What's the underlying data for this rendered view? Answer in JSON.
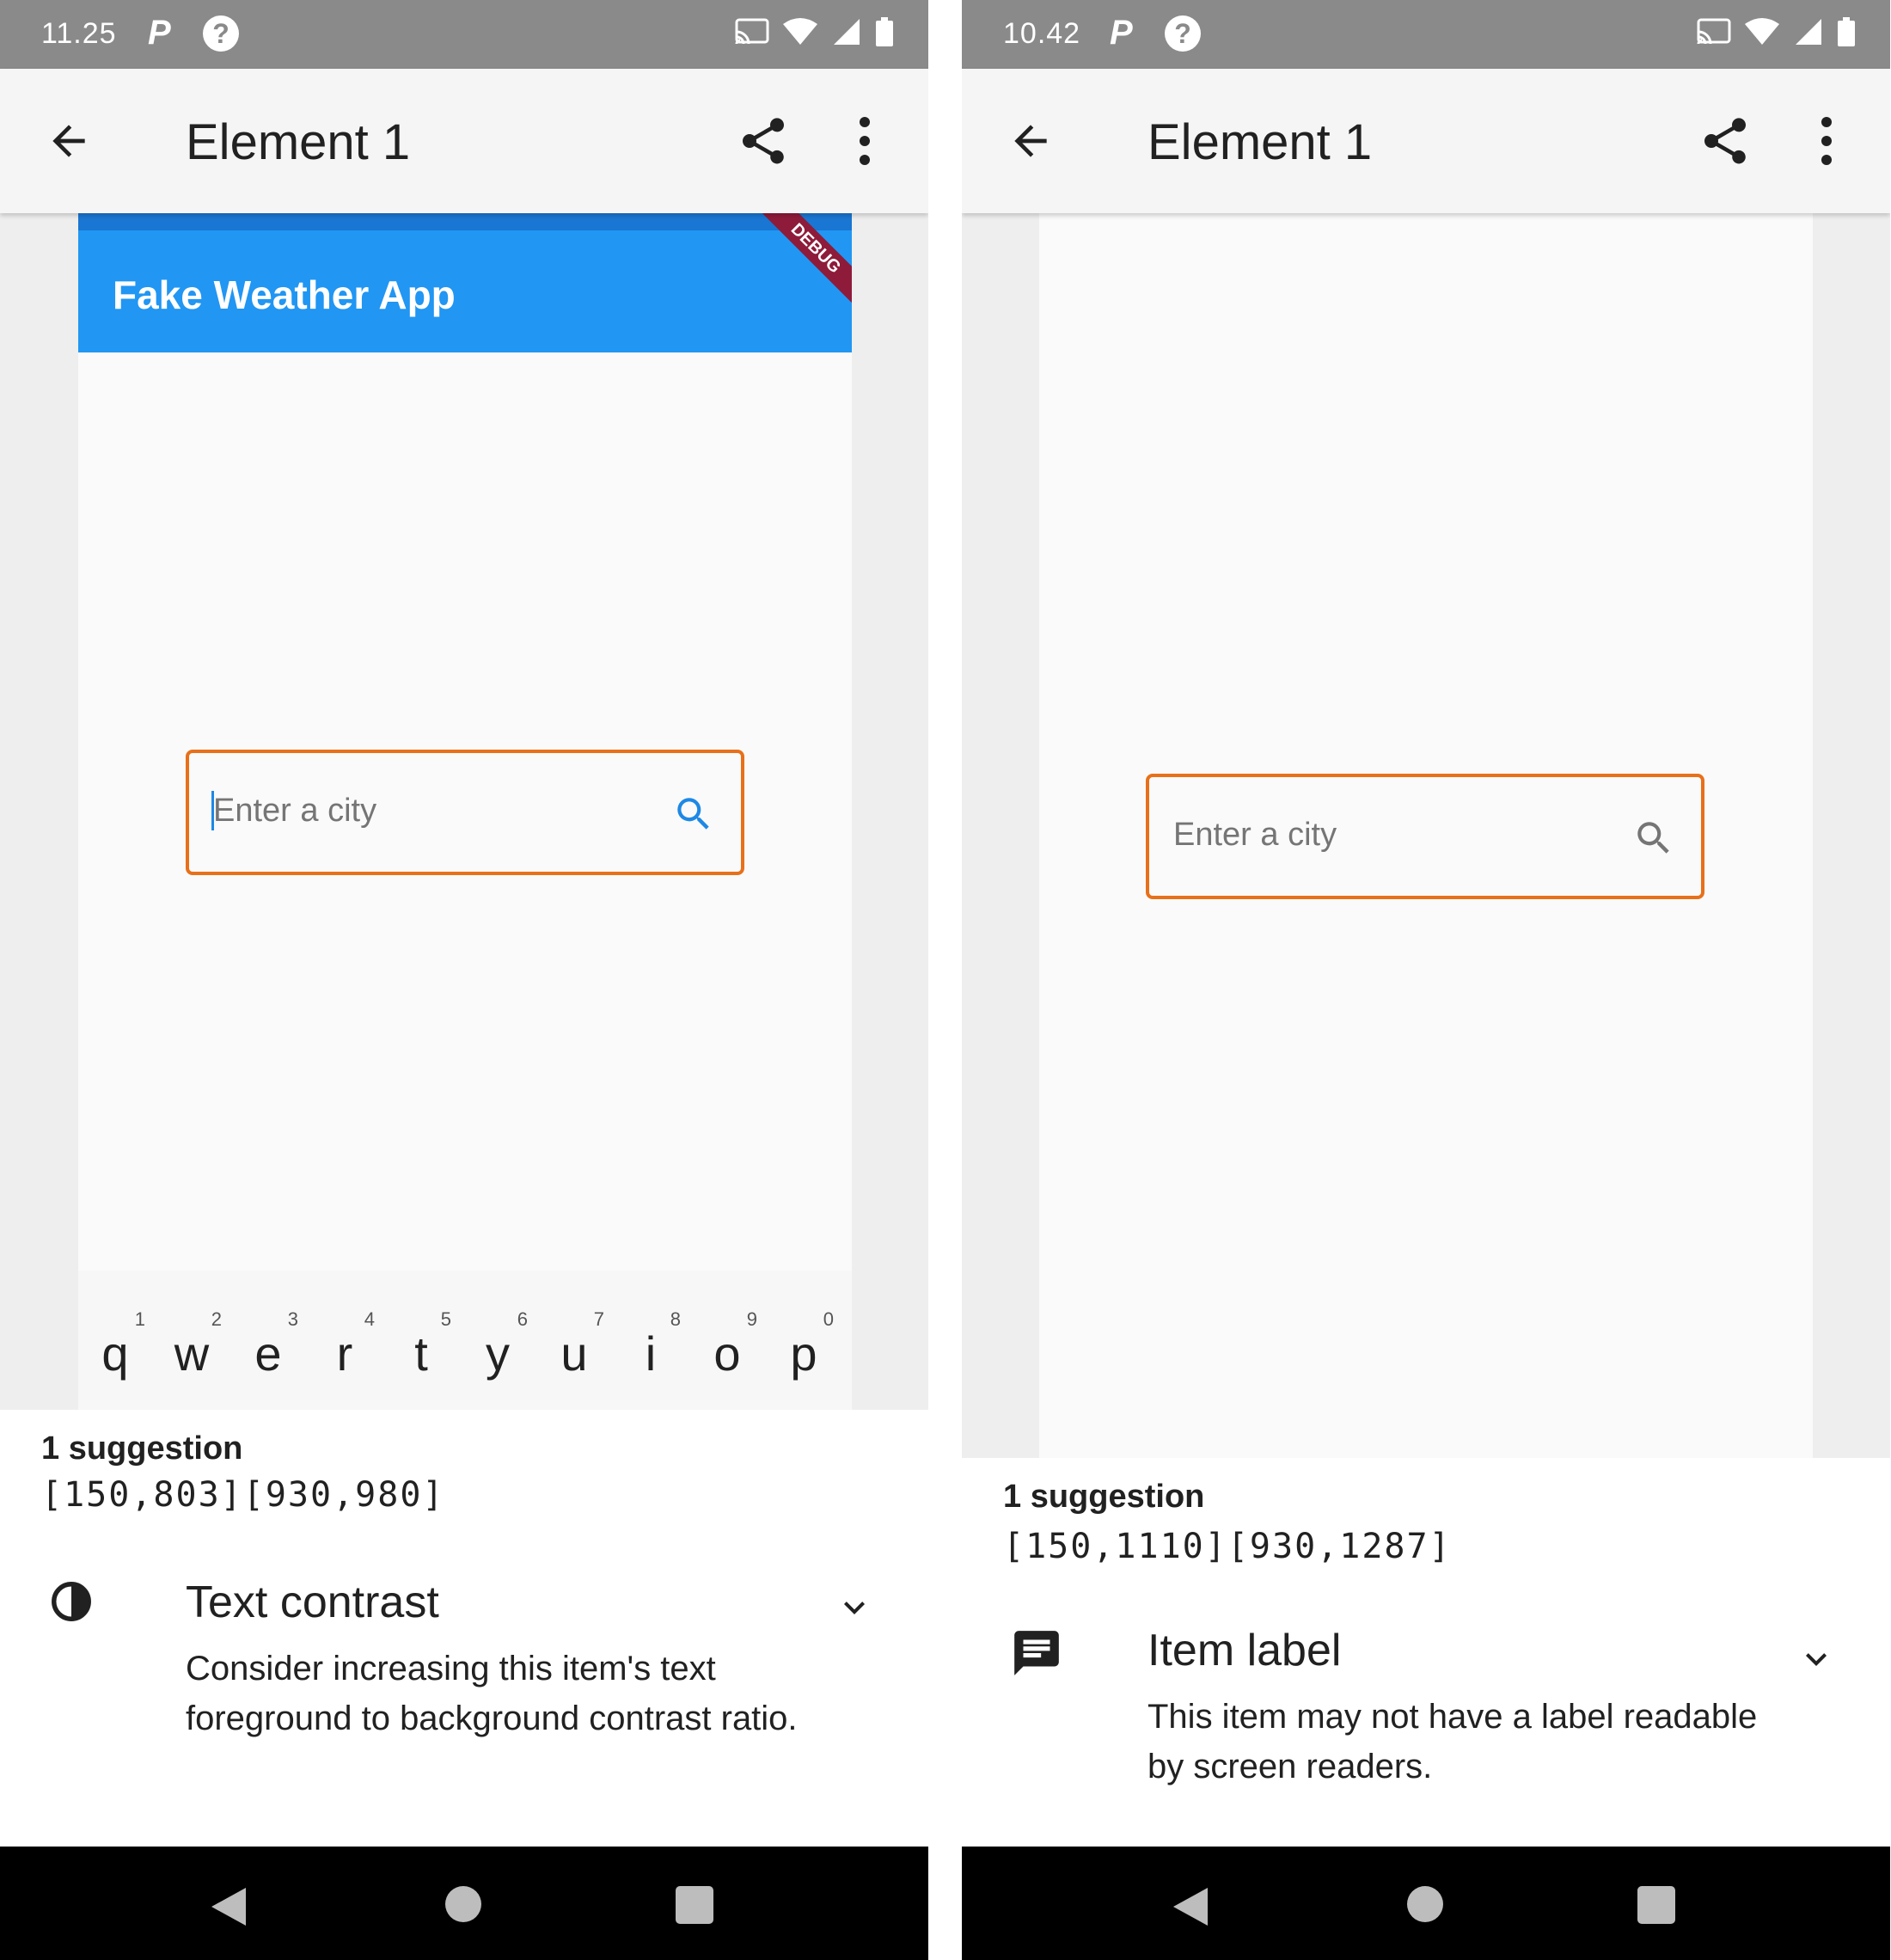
{
  "colors": {
    "highlight": "#e8701a",
    "accent_blue": "#2196f3",
    "status_bar": "#8a8a8a"
  },
  "screens": [
    {
      "status": {
        "time": "11.25",
        "p_letter": "P",
        "help": "?"
      },
      "appbar": {
        "title": "Element 1"
      },
      "app": {
        "title": "Fake Weather App",
        "debug": "DEBUG"
      },
      "field": {
        "placeholder": "Enter a city"
      },
      "keyboard": [
        {
          "num": "1",
          "char": "q"
        },
        {
          "num": "2",
          "char": "w"
        },
        {
          "num": "3",
          "char": "e"
        },
        {
          "num": "4",
          "char": "r"
        },
        {
          "num": "5",
          "char": "t"
        },
        {
          "num": "6",
          "char": "y"
        },
        {
          "num": "7",
          "char": "u"
        },
        {
          "num": "8",
          "char": "i"
        },
        {
          "num": "9",
          "char": "o"
        },
        {
          "num": "0",
          "char": "p"
        }
      ],
      "suggestion": {
        "count": "1 suggestion",
        "bounds": "[150,803][930,980]",
        "icon": "contrast-icon",
        "title": "Text contrast",
        "description": "Consider increasing this item's text foreground to background contrast ratio."
      }
    },
    {
      "status": {
        "time": "10.42",
        "p_letter": "P",
        "help": "?"
      },
      "appbar": {
        "title": "Element 1"
      },
      "field": {
        "placeholder": "Enter a city"
      },
      "suggestion": {
        "count": "1 suggestion",
        "bounds": "[150,1110][930,1287]",
        "icon": "message-icon",
        "title": "Item label",
        "description": "This item may not have a label readable by screen readers."
      }
    }
  ]
}
